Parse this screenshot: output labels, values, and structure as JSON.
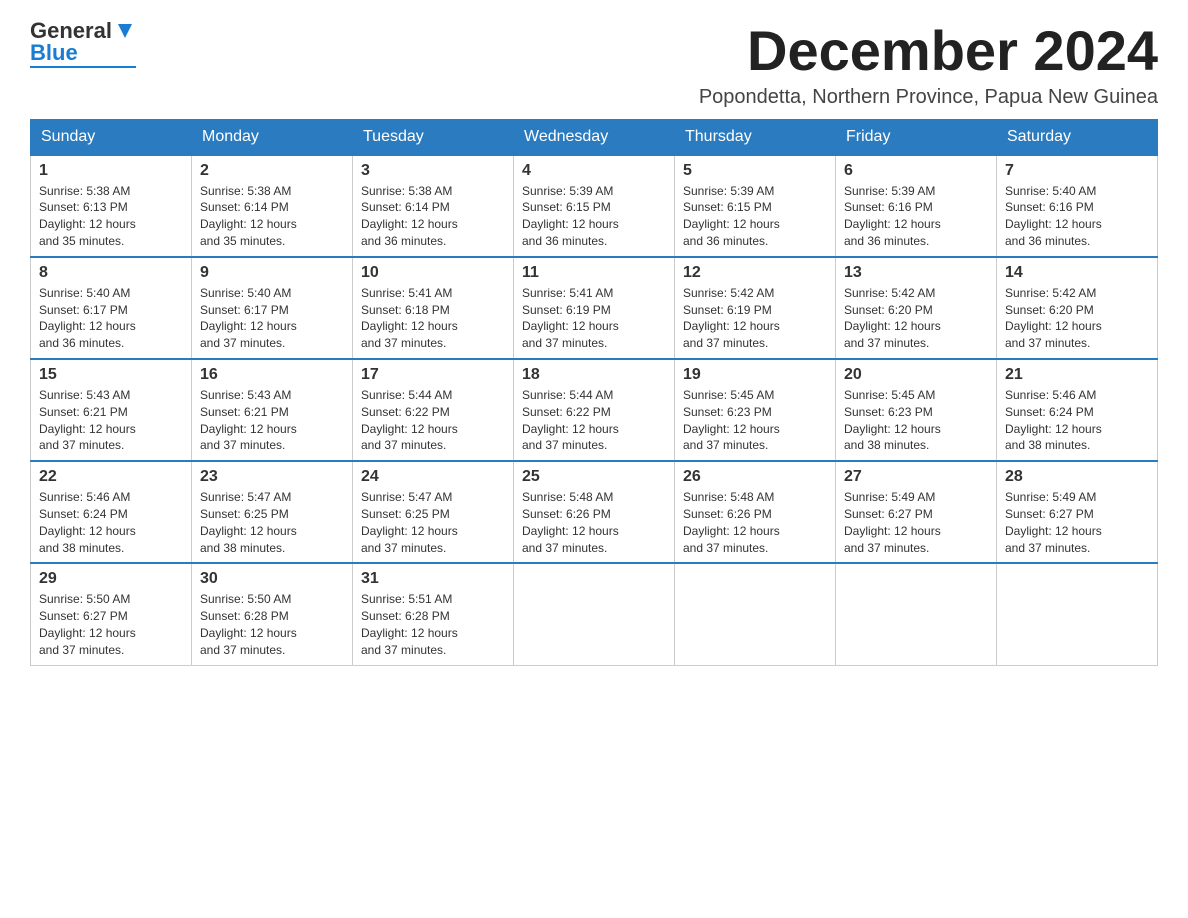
{
  "header": {
    "logo_general": "General",
    "logo_blue": "Blue",
    "month_title": "December 2024",
    "subtitle": "Popondetta, Northern Province, Papua New Guinea"
  },
  "days_of_week": [
    "Sunday",
    "Monday",
    "Tuesday",
    "Wednesday",
    "Thursday",
    "Friday",
    "Saturday"
  ],
  "weeks": [
    [
      {
        "day": "1",
        "sunrise": "5:38 AM",
        "sunset": "6:13 PM",
        "daylight": "12 hours and 35 minutes."
      },
      {
        "day": "2",
        "sunrise": "5:38 AM",
        "sunset": "6:14 PM",
        "daylight": "12 hours and 35 minutes."
      },
      {
        "day": "3",
        "sunrise": "5:38 AM",
        "sunset": "6:14 PM",
        "daylight": "12 hours and 36 minutes."
      },
      {
        "day": "4",
        "sunrise": "5:39 AM",
        "sunset": "6:15 PM",
        "daylight": "12 hours and 36 minutes."
      },
      {
        "day": "5",
        "sunrise": "5:39 AM",
        "sunset": "6:15 PM",
        "daylight": "12 hours and 36 minutes."
      },
      {
        "day": "6",
        "sunrise": "5:39 AM",
        "sunset": "6:16 PM",
        "daylight": "12 hours and 36 minutes."
      },
      {
        "day": "7",
        "sunrise": "5:40 AM",
        "sunset": "6:16 PM",
        "daylight": "12 hours and 36 minutes."
      }
    ],
    [
      {
        "day": "8",
        "sunrise": "5:40 AM",
        "sunset": "6:17 PM",
        "daylight": "12 hours and 36 minutes."
      },
      {
        "day": "9",
        "sunrise": "5:40 AM",
        "sunset": "6:17 PM",
        "daylight": "12 hours and 37 minutes."
      },
      {
        "day": "10",
        "sunrise": "5:41 AM",
        "sunset": "6:18 PM",
        "daylight": "12 hours and 37 minutes."
      },
      {
        "day": "11",
        "sunrise": "5:41 AM",
        "sunset": "6:19 PM",
        "daylight": "12 hours and 37 minutes."
      },
      {
        "day": "12",
        "sunrise": "5:42 AM",
        "sunset": "6:19 PM",
        "daylight": "12 hours and 37 minutes."
      },
      {
        "day": "13",
        "sunrise": "5:42 AM",
        "sunset": "6:20 PM",
        "daylight": "12 hours and 37 minutes."
      },
      {
        "day": "14",
        "sunrise": "5:42 AM",
        "sunset": "6:20 PM",
        "daylight": "12 hours and 37 minutes."
      }
    ],
    [
      {
        "day": "15",
        "sunrise": "5:43 AM",
        "sunset": "6:21 PM",
        "daylight": "12 hours and 37 minutes."
      },
      {
        "day": "16",
        "sunrise": "5:43 AM",
        "sunset": "6:21 PM",
        "daylight": "12 hours and 37 minutes."
      },
      {
        "day": "17",
        "sunrise": "5:44 AM",
        "sunset": "6:22 PM",
        "daylight": "12 hours and 37 minutes."
      },
      {
        "day": "18",
        "sunrise": "5:44 AM",
        "sunset": "6:22 PM",
        "daylight": "12 hours and 37 minutes."
      },
      {
        "day": "19",
        "sunrise": "5:45 AM",
        "sunset": "6:23 PM",
        "daylight": "12 hours and 37 minutes."
      },
      {
        "day": "20",
        "sunrise": "5:45 AM",
        "sunset": "6:23 PM",
        "daylight": "12 hours and 38 minutes."
      },
      {
        "day": "21",
        "sunrise": "5:46 AM",
        "sunset": "6:24 PM",
        "daylight": "12 hours and 38 minutes."
      }
    ],
    [
      {
        "day": "22",
        "sunrise": "5:46 AM",
        "sunset": "6:24 PM",
        "daylight": "12 hours and 38 minutes."
      },
      {
        "day": "23",
        "sunrise": "5:47 AM",
        "sunset": "6:25 PM",
        "daylight": "12 hours and 38 minutes."
      },
      {
        "day": "24",
        "sunrise": "5:47 AM",
        "sunset": "6:25 PM",
        "daylight": "12 hours and 37 minutes."
      },
      {
        "day": "25",
        "sunrise": "5:48 AM",
        "sunset": "6:26 PM",
        "daylight": "12 hours and 37 minutes."
      },
      {
        "day": "26",
        "sunrise": "5:48 AM",
        "sunset": "6:26 PM",
        "daylight": "12 hours and 37 minutes."
      },
      {
        "day": "27",
        "sunrise": "5:49 AM",
        "sunset": "6:27 PM",
        "daylight": "12 hours and 37 minutes."
      },
      {
        "day": "28",
        "sunrise": "5:49 AM",
        "sunset": "6:27 PM",
        "daylight": "12 hours and 37 minutes."
      }
    ],
    [
      {
        "day": "29",
        "sunrise": "5:50 AM",
        "sunset": "6:27 PM",
        "daylight": "12 hours and 37 minutes."
      },
      {
        "day": "30",
        "sunrise": "5:50 AM",
        "sunset": "6:28 PM",
        "daylight": "12 hours and 37 minutes."
      },
      {
        "day": "31",
        "sunrise": "5:51 AM",
        "sunset": "6:28 PM",
        "daylight": "12 hours and 37 minutes."
      },
      null,
      null,
      null,
      null
    ]
  ],
  "labels": {
    "sunrise": "Sunrise:",
    "sunset": "Sunset:",
    "daylight": "Daylight:"
  },
  "colors": {
    "header_bg": "#2a7bbf",
    "accent": "#1a7dd4"
  }
}
